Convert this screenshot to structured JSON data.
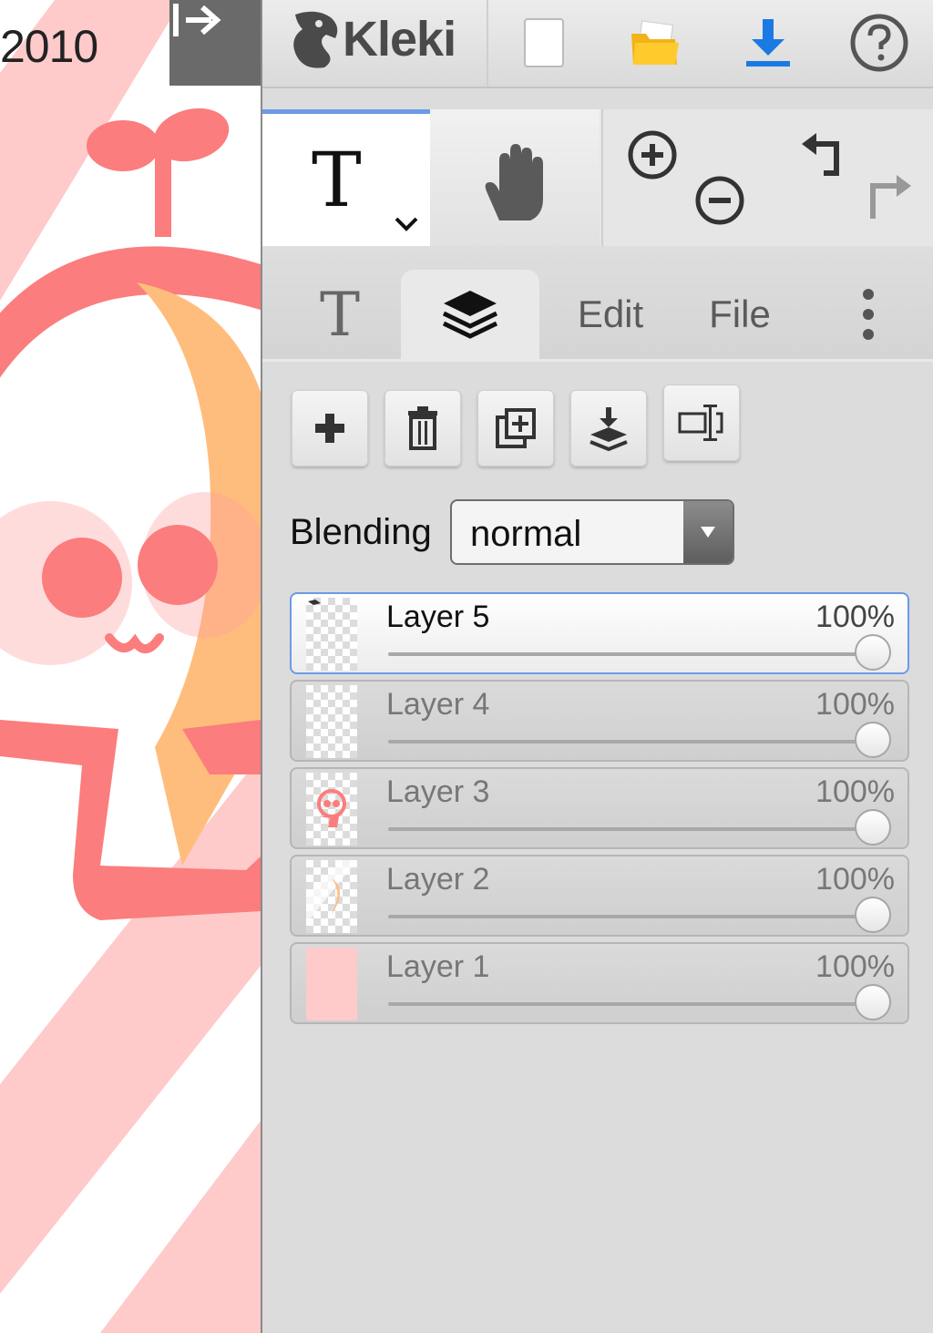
{
  "canvas": {
    "year_text": "2010",
    "colors": {
      "stripe": "#ffcaca",
      "character": "#fb7d7d",
      "accent": "#ffbd7d",
      "blush": "#ff9a9a",
      "background": "#ffffff"
    }
  },
  "toolbar": {
    "collapse_icon": "collapse-right-arrow-icon",
    "logo_text": "Kleki",
    "icons": [
      "new-file-icon",
      "open-folder-icon",
      "download-icon",
      "help-icon"
    ],
    "accent_color": "#1b79e3"
  },
  "tools": {
    "text_tool_glyph": "T",
    "text_tool_dropdown_icon": "chevron-down-icon",
    "hand_tool_icon": "hand-icon",
    "zoom_in_icon": "zoom-in-icon",
    "zoom_out_icon": "zoom-out-icon",
    "undo_icon": "undo-icon",
    "redo_icon": "redo-icon",
    "active_tool_indicator_color": "#6b9be6"
  },
  "tabs": {
    "tool_tab_glyph": "T",
    "layers_tab_icon": "layers-icon",
    "edit_label": "Edit",
    "file_label": "File",
    "more_icon": "more-vertical-icon"
  },
  "layer_actions": {
    "icons": [
      "add-layer-icon",
      "delete-layer-icon",
      "duplicate-layer-icon",
      "merge-down-icon",
      "rename-layer-icon"
    ]
  },
  "blending": {
    "label": "Blending",
    "value": "normal"
  },
  "layers": [
    {
      "name": "Layer 5",
      "opacity_label": "100%",
      "opacity": 1.0,
      "active": true
    },
    {
      "name": "Layer 4",
      "opacity_label": "100%",
      "opacity": 1.0,
      "active": false
    },
    {
      "name": "Layer 3",
      "opacity_label": "100%",
      "opacity": 1.0,
      "active": false
    },
    {
      "name": "Layer 2",
      "opacity_label": "100%",
      "opacity": 1.0,
      "active": false
    },
    {
      "name": "Layer 1",
      "opacity_label": "100%",
      "opacity": 1.0,
      "active": false
    }
  ]
}
